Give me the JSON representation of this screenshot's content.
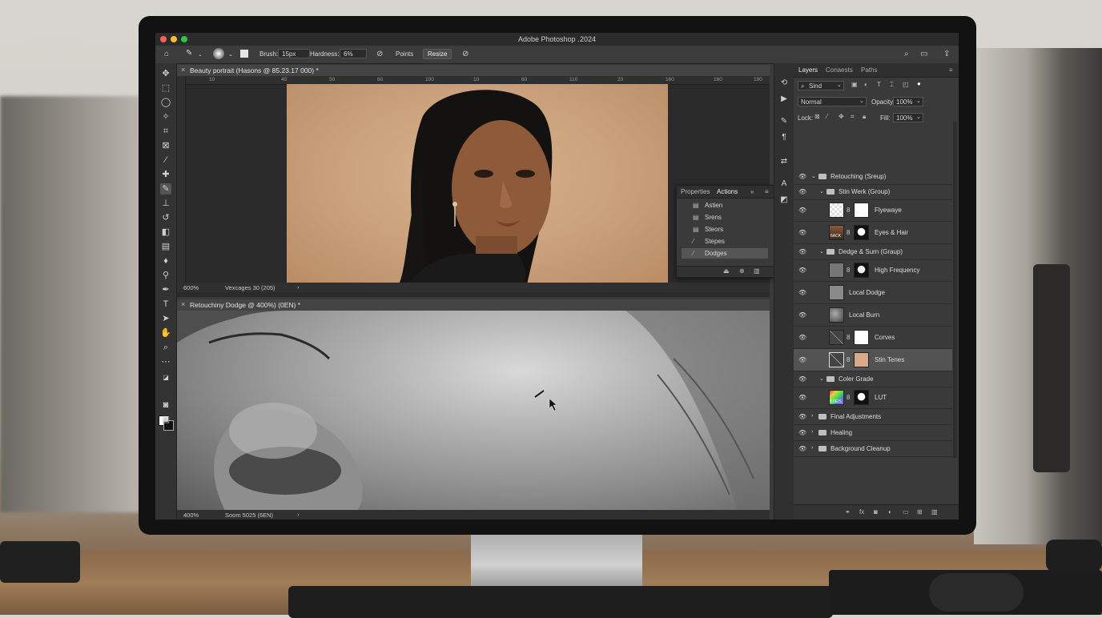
{
  "app": {
    "title": "Adobe Photoshop ․2024"
  },
  "options_bar": {
    "brush_label": "Brush:",
    "brush_size": "15px",
    "hardness_label": "Hardness:",
    "hardness_value": "6%",
    "points_label": "Points",
    "resize_button": "Resize"
  },
  "doc1": {
    "tab": "Beauty portrait (Hasons @ 85.23.17 000) *",
    "ruler_ticks": [
      "10",
      "40",
      "50",
      "60",
      "100",
      "10",
      "60",
      "110",
      "20",
      "160",
      "160",
      "190",
      "200",
      "50",
      "200",
      "200",
      "100",
      "100",
      "100",
      "190",
      "200",
      "250",
      "300",
      "150",
      "350"
    ],
    "zoom": "600%",
    "info": "Vexcages 30 (205)"
  },
  "doc2": {
    "tab": "Retouchiny Dodge @ 400%) (0EN) *",
    "zoom": "400%",
    "info": "Soom 5025 (6EN)"
  },
  "actions_panel": {
    "tabs": [
      "Properties",
      "Actions"
    ],
    "items": [
      {
        "label": "Astien",
        "icon": "list-icon"
      },
      {
        "label": "Srens",
        "icon": "list-icon"
      },
      {
        "label": "Steors",
        "icon": "list-icon"
      },
      {
        "label": "Stepes",
        "icon": "brush-icon"
      },
      {
        "label": "Dodges",
        "icon": "brush-icon"
      }
    ]
  },
  "layers_panel": {
    "tabs": [
      "Layers",
      "Conaests",
      "Paths"
    ],
    "filter_kind": "Sind",
    "blend_mode": "Normal",
    "opacity_label": "Opacity:",
    "opacity_value": "100%",
    "lock_label": "Lock:",
    "fill_label": "Fill:",
    "fill_value": "100%",
    "layers": [
      {
        "name": "Retouching (Sreup)",
        "type": "group",
        "level": 0,
        "expanded": true
      },
      {
        "name": "Stin Werk (Group)",
        "type": "group",
        "level": 1,
        "expanded": true
      },
      {
        "name": "Flyewaye",
        "type": "layer",
        "level": 2,
        "thumb": "checker"
      },
      {
        "name": "Eyes & Hair",
        "type": "layer",
        "level": 2,
        "thumb": "face",
        "thumb_label": "6ACK"
      },
      {
        "name": "Dedge & Surn (Graup)",
        "type": "group",
        "level": 1,
        "expanded": true
      },
      {
        "name": "High Frequency",
        "type": "layer",
        "level": 2,
        "thumb": "gray"
      },
      {
        "name": "Local Dodge",
        "type": "layer",
        "level": 2,
        "thumb": "gray-noise"
      },
      {
        "name": "Local Burn",
        "type": "layer",
        "level": 2,
        "thumb": "gray-dark"
      },
      {
        "name": "Corves",
        "type": "adjust",
        "level": 2,
        "thumb": "curves"
      },
      {
        "name": "Stin Tenes",
        "type": "adjust",
        "level": 2,
        "thumb": "curves",
        "selected": true,
        "fill": "#d8a98a"
      },
      {
        "name": "Coler Grade",
        "type": "group",
        "level": 1,
        "expanded": true
      },
      {
        "name": "LUT",
        "type": "layer",
        "level": 2,
        "thumb": "lut",
        "thumb_label": "6.0EIS"
      },
      {
        "name": "Final Adjustments",
        "type": "group",
        "level": 0,
        "expanded": false
      },
      {
        "name": "Healing",
        "type": "group",
        "level": 0,
        "expanded": false
      },
      {
        "name": "Background Cleanup",
        "type": "group",
        "level": 0,
        "expanded": false
      }
    ]
  },
  "colors": {
    "accent_selected": "#535353",
    "canvas_bg": "#2a2a2a"
  }
}
